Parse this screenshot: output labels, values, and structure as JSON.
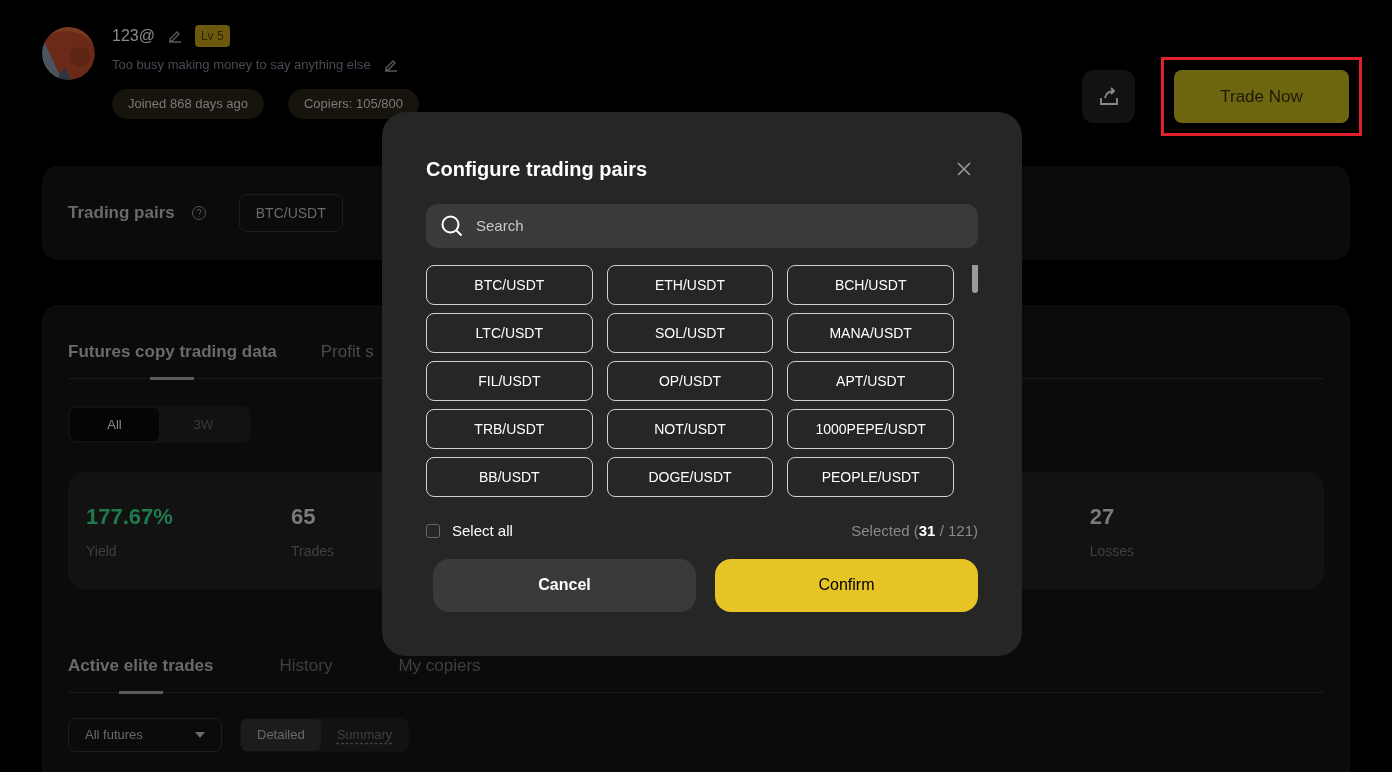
{
  "profile": {
    "name": "123@",
    "level": "Lv 5",
    "bio": "Too busy making money to say anything else",
    "badges": [
      "Joined 868 days ago",
      "Copiers: 105/800"
    ]
  },
  "trade_button": {
    "label": "Trade Now",
    "highlighted": true
  },
  "trading_pairs": {
    "title": "Trading pairs",
    "pairs": [
      "BTC/USDT"
    ]
  },
  "data_section": {
    "tabs": [
      {
        "label": "Futures copy trading data",
        "selected": true
      },
      {
        "label": "Profit s",
        "selected": false
      }
    ],
    "periods": [
      {
        "label": "All",
        "selected": true
      },
      {
        "label": "3W",
        "selected": false
      }
    ],
    "stats": [
      {
        "value": "177.67%",
        "label": "Yield",
        "kind": "positive"
      },
      {
        "value": "65",
        "label": "Trades",
        "kind": "neutral"
      },
      {
        "value": "27",
        "label": "Losses",
        "kind": "neutral"
      }
    ]
  },
  "trades_section": {
    "tabs": [
      {
        "label": "Active elite trades",
        "selected": true
      },
      {
        "label": "History",
        "selected": false
      },
      {
        "label": "My copiers",
        "selected": false
      }
    ],
    "filter": {
      "value": "All futures"
    },
    "view_modes": [
      {
        "label": "Detailed",
        "selected": true
      },
      {
        "label": "Summary",
        "selected": false
      }
    ]
  },
  "dialog": {
    "title": "Configure trading pairs",
    "search": {
      "placeholder": "Search"
    },
    "pairs": [
      "BTC/USDT",
      "ETH/USDT",
      "BCH/USDT",
      "LTC/USDT",
      "SOL/USDT",
      "MANA/USDT",
      "FIL/USDT",
      "OP/USDT",
      "APT/USDT",
      "TRB/USDT",
      "NOT/USDT",
      "1000PEPE/USDT",
      "BB/USDT",
      "DOGE/USDT",
      "PEOPLE/USDT"
    ],
    "select_all": {
      "label": "Select all",
      "checked": false
    },
    "selected_count": "Selected (**31** / 121)",
    "buttons": [
      {
        "label": "Cancel",
        "kind": "secondary"
      },
      {
        "label": "Confirm",
        "kind": "primary"
      }
    ]
  }
}
